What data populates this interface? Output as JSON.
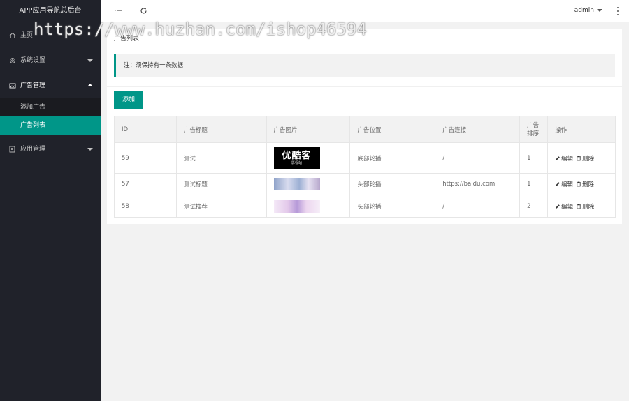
{
  "app": {
    "title": "APP应用导航总后台"
  },
  "sidebar": {
    "items": [
      {
        "label": "主页",
        "icon": "home-icon"
      },
      {
        "label": "系统设置",
        "icon": "gear-icon"
      },
      {
        "label": "广告管理",
        "icon": "image-icon",
        "expanded": true,
        "children": [
          {
            "label": "添加广告"
          },
          {
            "label": "广告列表",
            "active": true
          }
        ]
      },
      {
        "label": "应用管理",
        "icon": "app-icon"
      }
    ]
  },
  "header": {
    "user": "admin"
  },
  "card": {
    "title": "广告列表",
    "notice": "注：须保持有一条数据",
    "add_label": "添加"
  },
  "table": {
    "headers": [
      "ID",
      "广告标题",
      "广告图片",
      "广告位置",
      "广告连接",
      "广告排序",
      "操作"
    ],
    "sort_header": [
      "广告",
      "排序"
    ],
    "rows": [
      {
        "id": "59",
        "title": "测试",
        "image": "banner-logo",
        "position": "底部轮播",
        "link": "/",
        "sort": "1"
      },
      {
        "id": "57",
        "title": "测试标题",
        "image": "banner-1",
        "position": "头部轮播",
        "link": "https://baidu.com",
        "sort": "1"
      },
      {
        "id": "58",
        "title": "测试推荐",
        "image": "banner-2",
        "position": "头部轮播",
        "link": "/",
        "sort": "2"
      }
    ],
    "edit_label": "编辑",
    "delete_label": "删除"
  },
  "thumb": {
    "logo_text": "优酷客",
    "logo_sub": "影视站"
  },
  "watermark": "https://www.huzhan.com/ishop46594",
  "colors": {
    "accent": "#009688",
    "sidebar_bg": "#20222a"
  }
}
